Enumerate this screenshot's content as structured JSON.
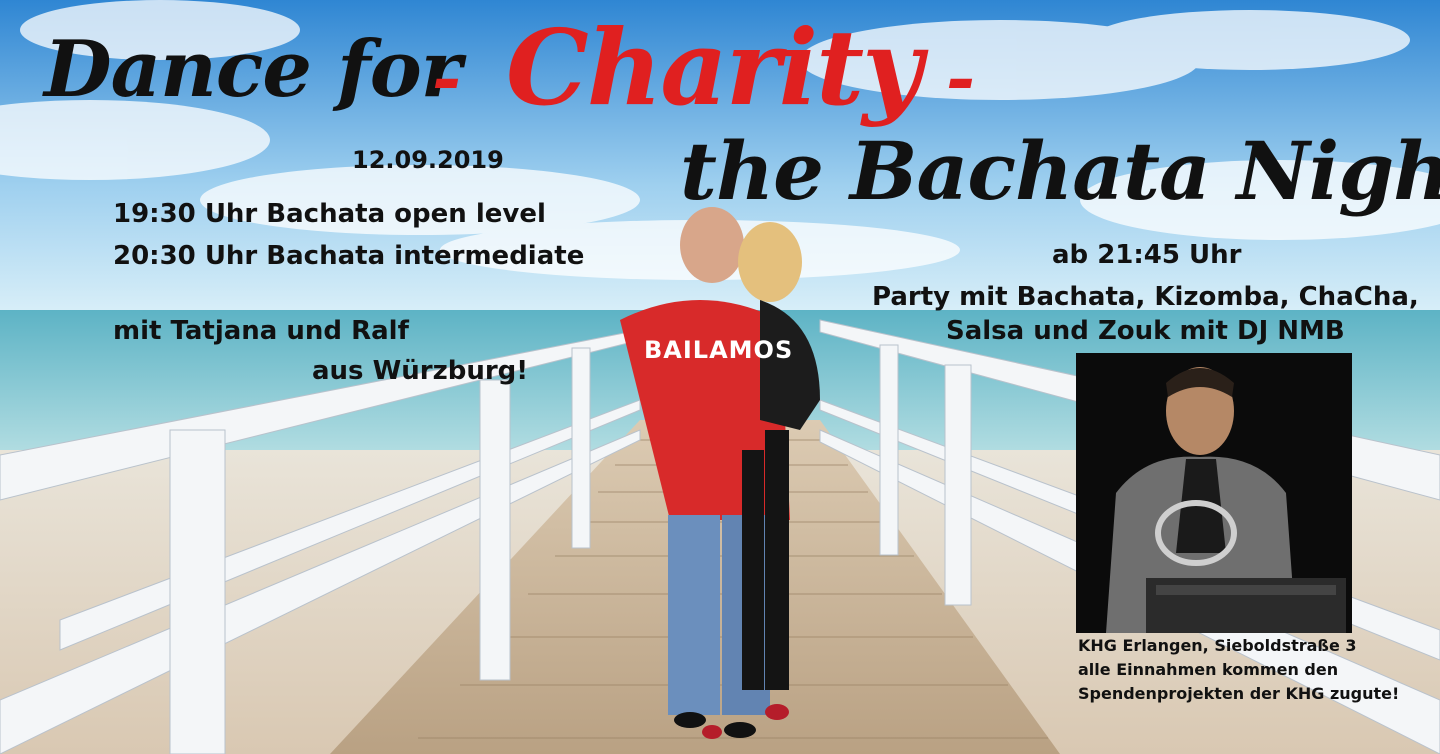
{
  "title": {
    "line1": "Dance for",
    "dash": "-",
    "charity": "Charity",
    "line2": "the Bachata Night"
  },
  "event": {
    "date": "12.09.2019",
    "classes": [
      "19:30 Uhr Bachata open level",
      "20:30 Uhr Bachata intermediate"
    ],
    "teachers_line1": "mit Tatjana und Ralf",
    "teachers_line2": "aus Würzburg!"
  },
  "party": {
    "time": "ab 21:45 Uhr",
    "line1": "Party mit Bachata, Kizomba, ChaCha,",
    "line2": "Salsa und Zouk mit DJ NMB"
  },
  "footer": {
    "line1": "KHG Erlangen, Sieboldstraße 3",
    "line2": "alle Einnahmen kommen den",
    "line3": "Spendenprojekten der KHG zugute!"
  },
  "shirt_logo": "BAILAMOS",
  "colors": {
    "accent_red": "#e02020",
    "text_dark": "#111111",
    "sky_top": "#3f8fd6",
    "sea": "#7fc3cf",
    "sand": "#e8dccb",
    "pier_wood": "#c9b59a",
    "railing": "#f4f6f8"
  }
}
